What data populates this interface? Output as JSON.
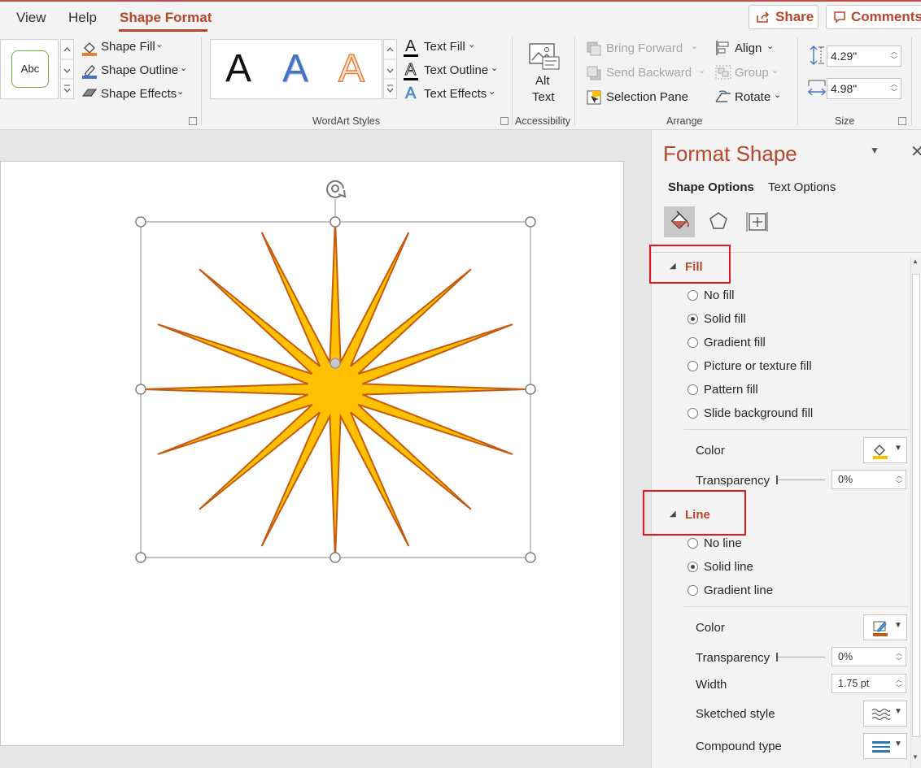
{
  "tabs": {
    "view": "View",
    "help": "Help",
    "shape_format": "Shape Format"
  },
  "top_buttons": {
    "share": "Share",
    "comments": "Comments"
  },
  "ribbon": {
    "shape_style_sample": "Abc",
    "shape_fill": "Shape Fill",
    "shape_outline": "Shape Outline",
    "shape_effects": "Shape Effects",
    "wordart_letter": "A",
    "text_fill": "Text Fill",
    "text_outline": "Text Outline",
    "text_effects": "Text Effects",
    "wordart_group": "WordArt Styles",
    "alt_text_line1": "Alt",
    "alt_text_line2": "Text",
    "accessibility_group": "Accessibility",
    "bring_forward": "Bring Forward",
    "send_backward": "Send Backward",
    "selection_pane": "Selection Pane",
    "align": "Align",
    "group": "Group",
    "rotate": "Rotate",
    "arrange_group": "Arrange",
    "height_value": "4.29\"",
    "width_value": "4.98\"",
    "size_group": "Size"
  },
  "pane": {
    "title": "Format Shape",
    "tab_shape_options": "Shape Options",
    "tab_text_options": "Text Options",
    "fill_header": "Fill",
    "fill_options": [
      "No fill",
      "Solid fill",
      "Gradient fill",
      "Picture or texture fill",
      "Pattern fill",
      "Slide background fill"
    ],
    "fill_selected": 1,
    "fill_color_label": "Color",
    "fill_transparency_label": "Transparency",
    "fill_transparency_value": "0%",
    "line_header": "Line",
    "line_options": [
      "No line",
      "Solid line",
      "Gradient line"
    ],
    "line_selected": 1,
    "line_color_label": "Color",
    "line_transparency_label": "Transparency",
    "line_transparency_value": "0%",
    "width_label": "Width",
    "width_value": "1.75 pt",
    "sketched_label": "Sketched style",
    "compound_label": "Compound type"
  },
  "colors": {
    "accent": "#b7472a",
    "star_fill": "#ffc000",
    "star_outline": "#c55a11",
    "highlight": "#d71920"
  }
}
